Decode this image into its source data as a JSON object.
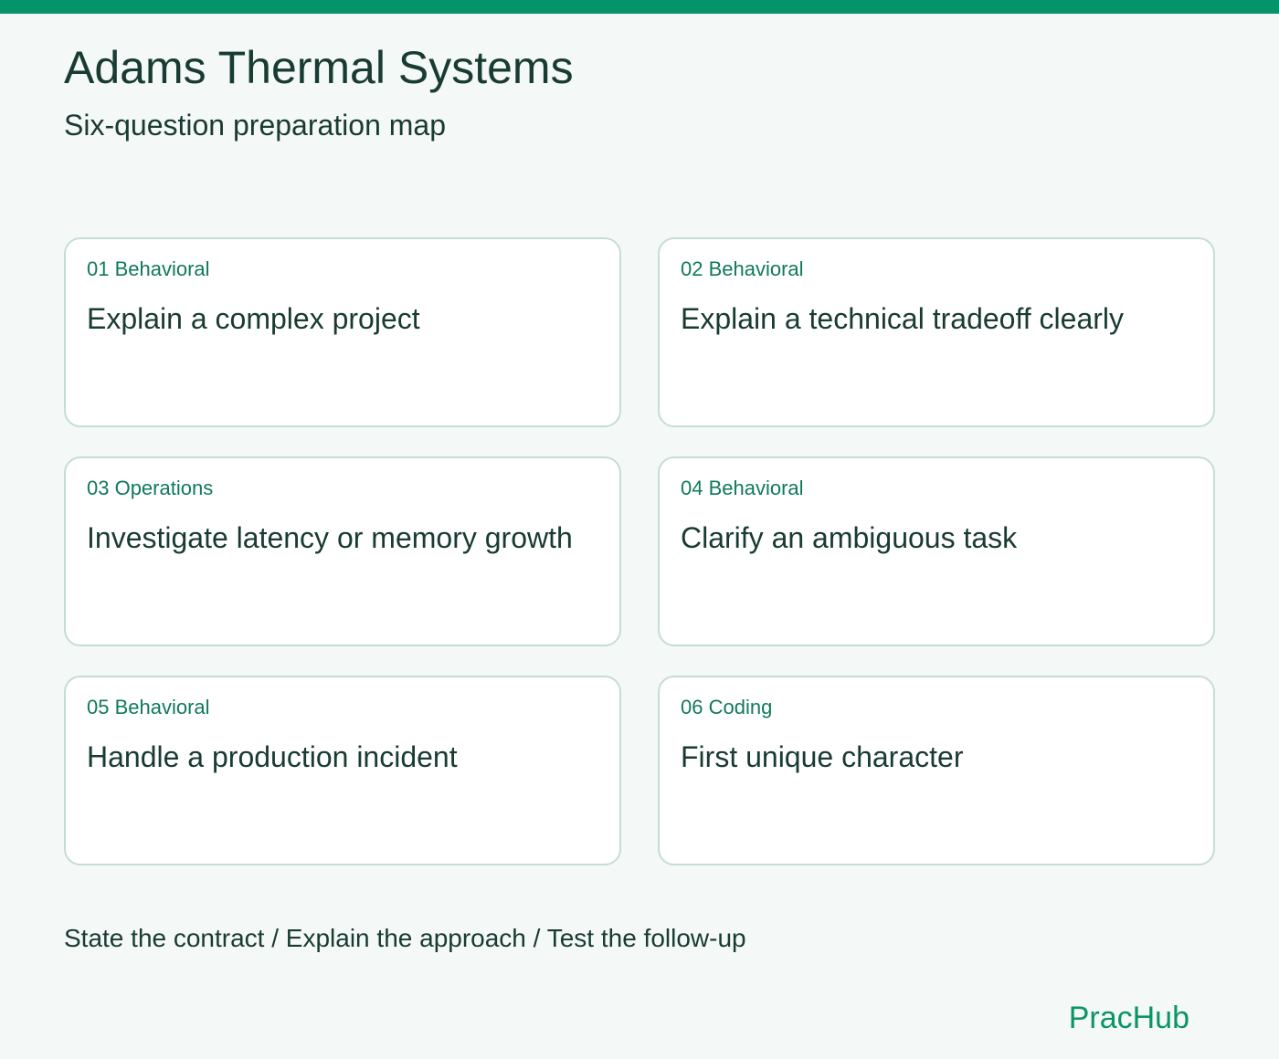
{
  "header": {
    "title": "Adams Thermal Systems",
    "subtitle": "Six-question preparation map"
  },
  "cards": [
    {
      "tag": "01 Behavioral",
      "title": "Explain a complex project"
    },
    {
      "tag": "02 Behavioral",
      "title": "Explain a technical tradeoff clearly"
    },
    {
      "tag": "03 Operations",
      "title": "Investigate latency or memory growth"
    },
    {
      "tag": "04 Behavioral",
      "title": "Clarify an ambiguous task"
    },
    {
      "tag": "05 Behavioral",
      "title": "Handle a production incident"
    },
    {
      "tag": "06 Coding",
      "title": "First unique character"
    }
  ],
  "footer": {
    "note": "State the contract / Explain the approach / Test the follow-up",
    "brand": "PracHub"
  },
  "colors": {
    "accent": "#039569",
    "tag_text": "#0f7a5b",
    "brand_text": "#0a9565",
    "body_text": "#183b33",
    "background": "#f4f8f6",
    "card_border": "#c5ddd5"
  }
}
